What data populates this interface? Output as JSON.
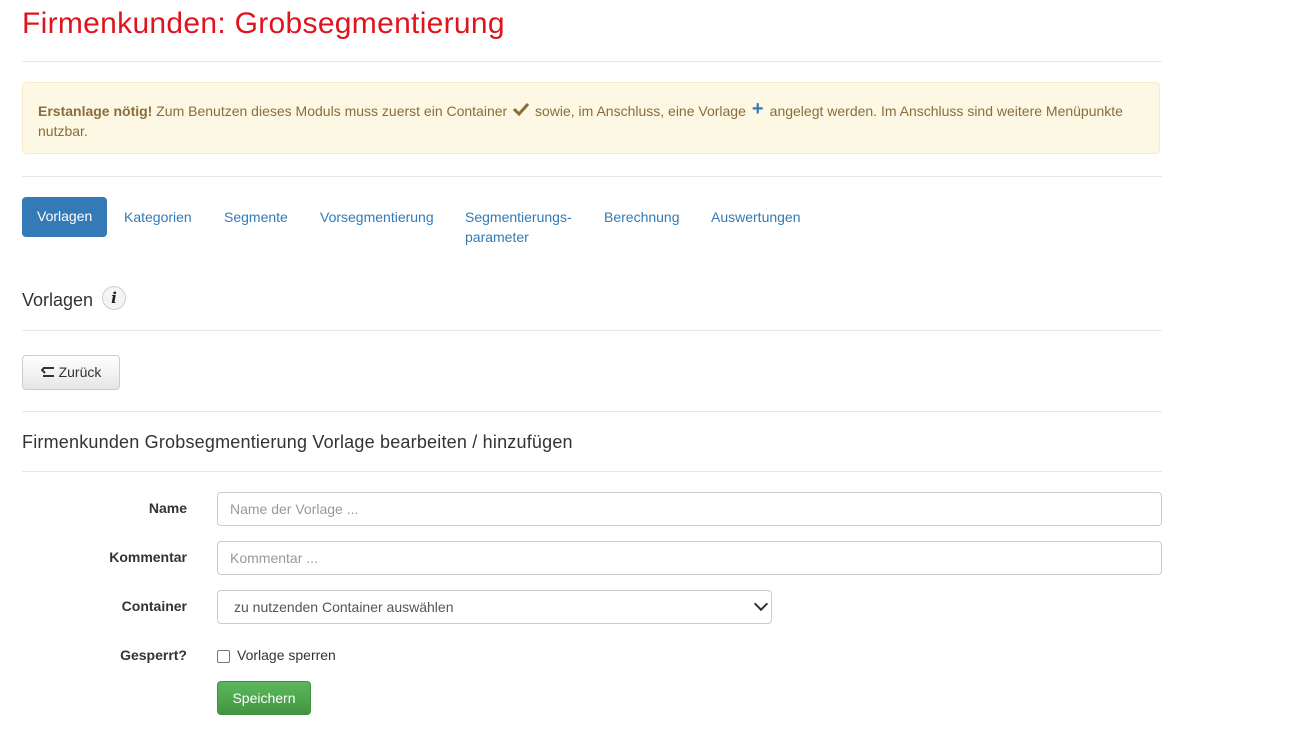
{
  "page": {
    "title": "Firmenkunden: Grobsegmentierung"
  },
  "alert": {
    "strong": "Erstanlage nötig!",
    "text_part1": " Zum Benutzen dieses Moduls muss zuerst ein Container ",
    "check_icon": "check-icon",
    "text_part2": " sowie, im Anschluss, eine Vorlage ",
    "plus_icon": "plus-icon",
    "text_part3": " angelegt werden. Im Anschluss sind weitere Menüpunkte nutzbar."
  },
  "nav": {
    "items": [
      {
        "label": "Vorlagen",
        "active": true
      },
      {
        "label": "Kategorien"
      },
      {
        "label": "Segmente"
      },
      {
        "label": "Vorsegmentierung"
      },
      {
        "label_line1": "Segmentierungs-",
        "label_line2": "parameter"
      },
      {
        "label": "Berechnung"
      },
      {
        "label": "Auswertungen"
      }
    ]
  },
  "section": {
    "title": "Vorlagen",
    "info_icon": "i"
  },
  "back_button": {
    "label": "Zurück"
  },
  "form": {
    "title": "Firmenkunden Grobsegmentierung Vorlage bearbeiten / hinzufügen",
    "name_label": "Name",
    "name_placeholder": "Name der Vorlage ...",
    "comment_label": "Kommentar",
    "comment_placeholder": "Kommentar ...",
    "container_label": "Container",
    "container_selected": "zu nutzenden Container auswählen",
    "locked_label": "Gesperrt?",
    "locked_checkbox_label": "Vorlage sperren",
    "locked_checked": false,
    "save_label": "Speichern"
  },
  "colors": {
    "title": "#e0141e",
    "link": "#337ab7",
    "alert_bg": "#fcf8e3",
    "alert_text": "#8a6d3b",
    "save_button": "#5cb85c"
  }
}
